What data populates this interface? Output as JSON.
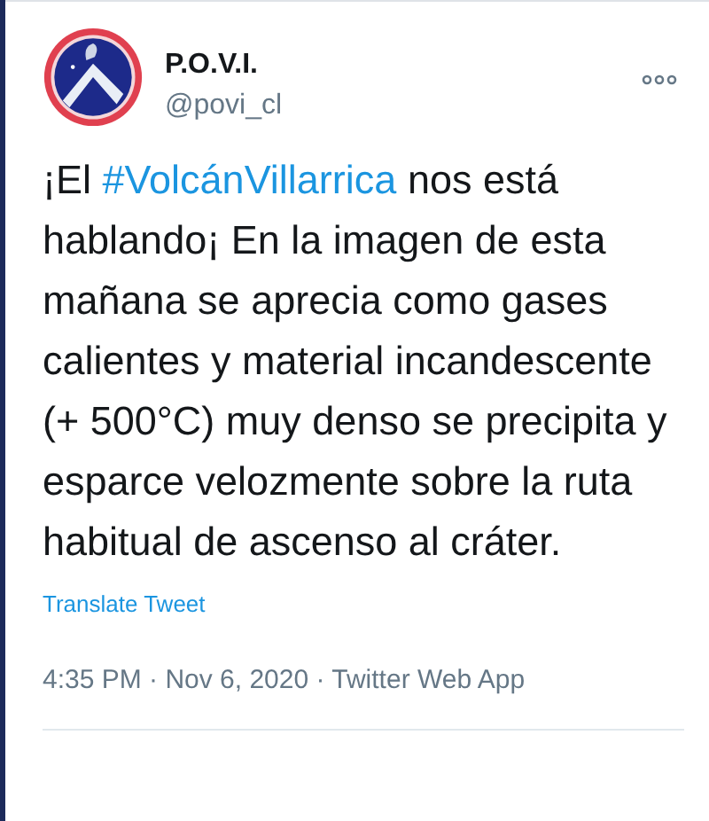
{
  "author": {
    "name": "P.O.V.I.",
    "handle": "@povi_cl"
  },
  "tweet": {
    "text_before": "¡El ",
    "hashtag": "#VolcánVillarrica",
    "text_after": " nos está hablando¡ En la imagen de esta mañana se aprecia como gases calientes y material incandescente (+ 500°C) muy denso se precipita y esparce velozmente sobre la ruta habitual de ascenso al cráter."
  },
  "translate_link": "Translate Tweet",
  "timestamp": "4:35 PM · Nov 6, 2020 · Twitter Web App"
}
